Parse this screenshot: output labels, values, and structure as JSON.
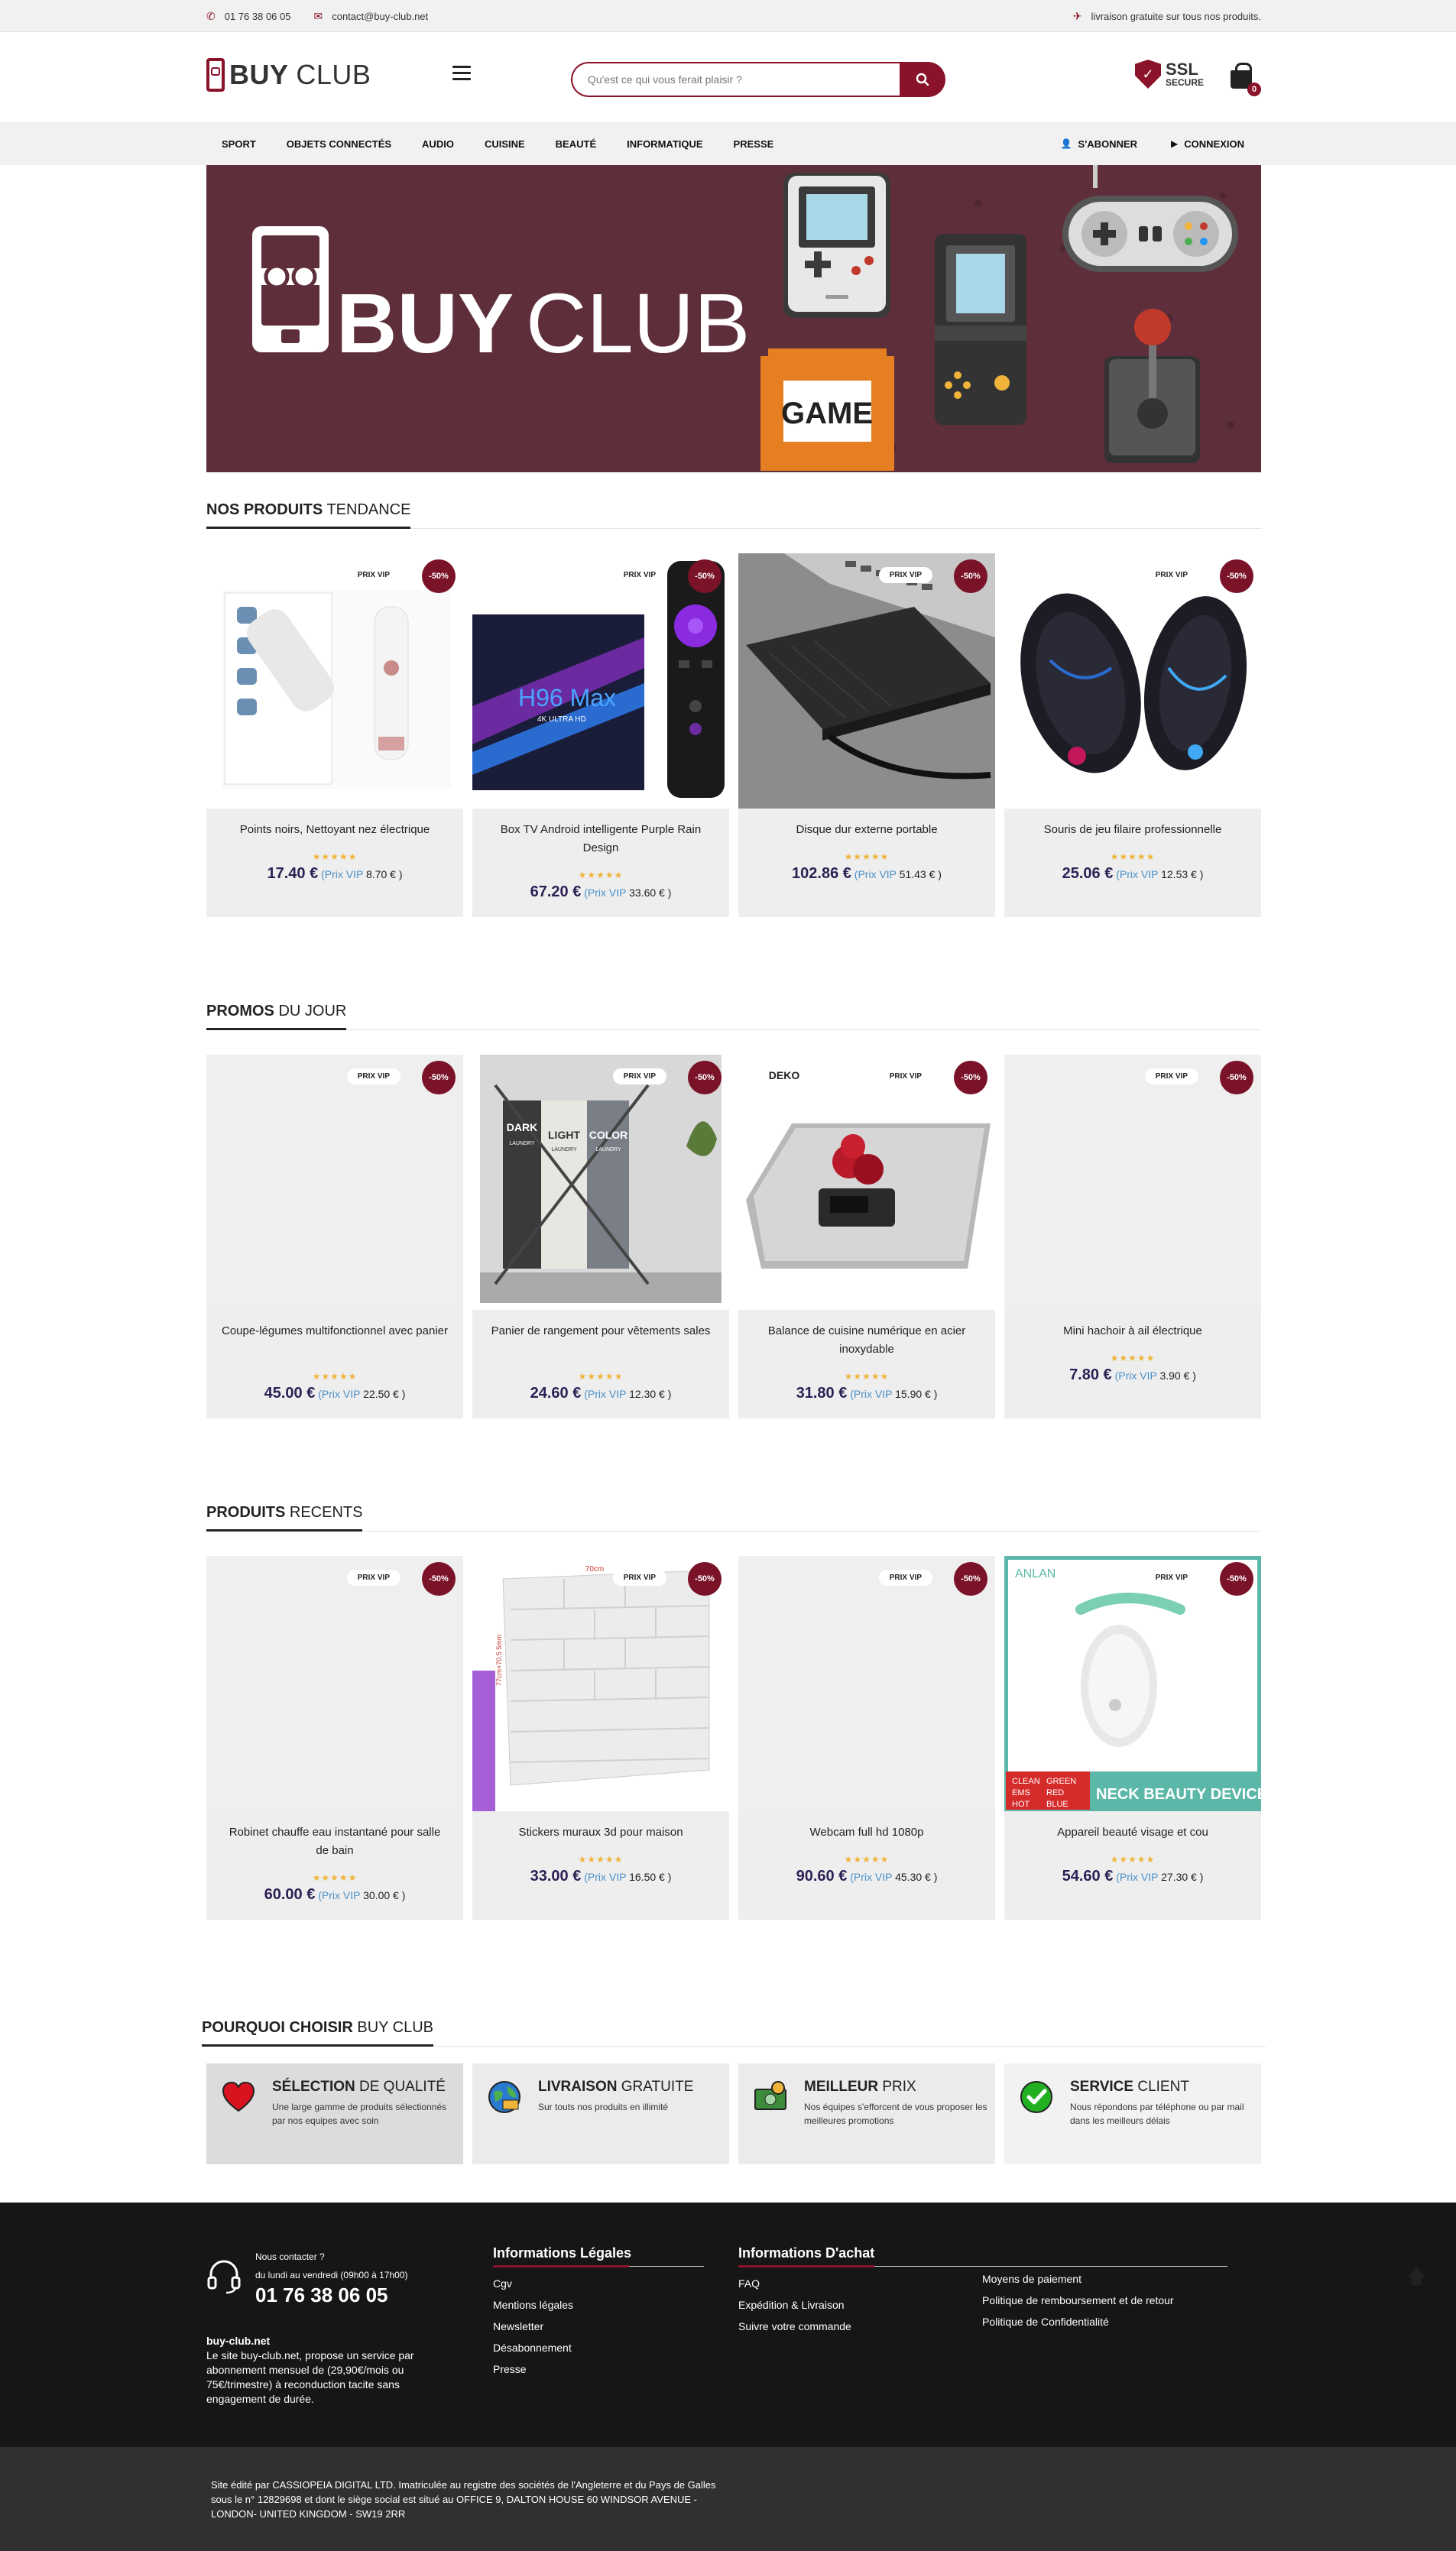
{
  "topbar": {
    "phone": "01 76 38 06 05",
    "email": "contact@buy-club.net",
    "shipping": "livraison gratuite sur tous nos produits."
  },
  "header": {
    "logo_bold": "BUY",
    "logo_light": "CLUB",
    "search_placeholder": "Qu'est ce qui vous ferait plaisir ?",
    "ssl_line1": "SSL",
    "ssl_line2": "SECURE",
    "cart_count": "0"
  },
  "nav": {
    "items": [
      "SPORT",
      "OBJETS CONNECTÉS",
      "AUDIO",
      "CUISINE",
      "BEAUTÉ",
      "INFORMATIQUE",
      "PRESSE"
    ],
    "subscribe": "S'ABONNER",
    "login": "CONNEXION"
  },
  "banner": {
    "logo_bold": "BUY",
    "logo_light": "CLUB",
    "game_label": "GAME"
  },
  "badges": {
    "vip": "PRIX VIP",
    "discount": "-50%",
    "vip_label": "(Prix VIP",
    "stars": "★★★★★"
  },
  "sections": [
    {
      "title_bold": "NOS PRODUITS",
      "title_light": " TENDANCE",
      "products": [
        {
          "name": "Points noirs, Nettoyant nez électrique",
          "price": "17.40 €",
          "vip": "8.70 € )"
        },
        {
          "name": "Box TV Android intelligente Purple Rain Design",
          "price": "67.20 €",
          "vip": "33.60 € )"
        },
        {
          "name": "Disque dur externe portable",
          "price": "102.86 €",
          "vip": "51.43 € )"
        },
        {
          "name": "Souris de jeu filaire professionnelle",
          "price": "25.06 €",
          "vip": "12.53 € )"
        }
      ]
    },
    {
      "title_bold": "PROMOS",
      "title_light": " DU JOUR",
      "products": [
        {
          "name": "Coupe-légumes multifonctionnel avec panier",
          "price": "45.00 €",
          "vip": "22.50 € )"
        },
        {
          "name": "Panier de rangement pour vêtements sales",
          "price": "24.60 €",
          "vip": "12.30 € )"
        },
        {
          "name": "Balance de cuisine numérique en acier inoxydable",
          "price": "31.80 €",
          "vip": "15.90 € )"
        },
        {
          "name": "Mini hachoir à ail électrique",
          "price": "7.80 €",
          "vip": "3.90 € )"
        }
      ]
    },
    {
      "title_bold": "PRODUITS",
      "title_light": " RECENTS",
      "products": [
        {
          "name": "Robinet chauffe eau instantané pour salle de bain",
          "price": "60.00 €",
          "vip": "30.00 € )"
        },
        {
          "name": "Stickers muraux 3d pour maison",
          "price": "33.00 €",
          "vip": "16.50 € )"
        },
        {
          "name": "Webcam full hd 1080p",
          "price": "90.60 €",
          "vip": "45.30 € )"
        },
        {
          "name": "Appareil beauté visage et cou",
          "price": "54.60 €",
          "vip": "27.30 € )"
        }
      ]
    }
  ],
  "images": {
    "hamper_labels": [
      "DARK",
      "LIGHT",
      "COLOR"
    ],
    "hamper_sub": "LAUNDRY",
    "scale_brand": "DEKO",
    "beauty_brand": "ANLAN",
    "beauty_tag": "NECK BEAUTY DEVICE",
    "beauty_modes": [
      "CLEAN",
      "GREEN",
      "EMS",
      "RED",
      "HOT",
      "BLUE"
    ],
    "sticker_dim_top": "70cm",
    "sticker_dim_side": "77cm×70.5 5mm",
    "tvbox_name": "H96 Max",
    "tvbox_sub": "4K ULTRA HD"
  },
  "why": {
    "title_bold": "POURQUOI CHOISIR",
    "title_light": " BUY CLUB",
    "items": [
      {
        "bold": "SÉLECTION",
        "light": " DE QUALITÉ",
        "desc": "Une large gamme de produits sélectionnés par nos equipes avec soin"
      },
      {
        "bold": "LIVRAISON",
        "light": " GRATUITE",
        "desc": "Sur touts nos produits en illimité"
      },
      {
        "bold": "MEILLEUR",
        "light": " PRIX",
        "desc": "Nos équipes s'efforcent de vous proposer les meilleures promotions"
      },
      {
        "bold": "SERVICE",
        "light": " CLIENT",
        "desc": "Nous répondons par téléphone ou par mail dans les meilleurs délais"
      }
    ]
  },
  "footer": {
    "contact_label": "Nous contacter ?",
    "hours": "du lundi au vendredi (09h00 à 17h00)",
    "phone": "01 76 38 06 05",
    "about_title": "buy-club.net",
    "about_text": "Le site buy-club.net, propose un service par abonnement mensuel de (29,90€/mois ou 75€/trimestre) à reconduction tacite sans engagement de durée.",
    "legal_title": "Informations Légales",
    "legal_links": [
      "Cgv",
      "Mentions légales",
      "Newsletter",
      "Désabonnement",
      "Presse"
    ],
    "purchase_title": "Informations D'achat",
    "purchase_links": [
      "FAQ",
      "Expédition & Livraison",
      "Suivre votre commande"
    ],
    "purchase_links2": [
      "Moyens de paiement",
      "Politique de remboursement et de retour",
      "Politique de Confidentialité"
    ],
    "legal_notice": "Site édité par CASSIOPEIA DIGITAL LTD. Imatriculée au registre des sociétés de l'Angleterre et du Pays de Galles sous le n° 12829698 et dont le siège social est situé au OFFICE 9, DALTON HOUSE 60 WINDSOR AVENUE - LONDON- UNITED KINGDOM - SW19 2RR"
  }
}
